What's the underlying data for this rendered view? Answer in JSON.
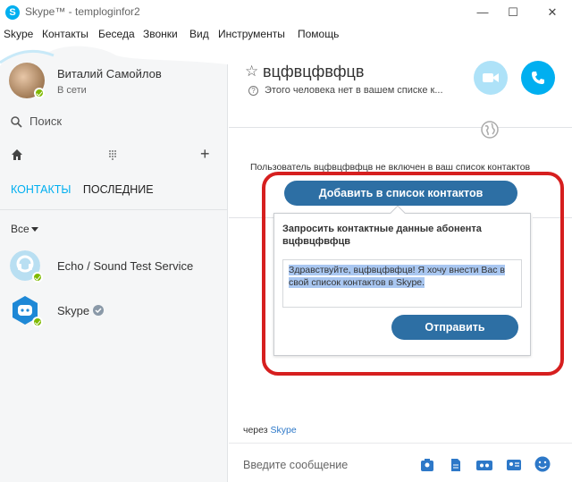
{
  "window": {
    "app_icon": "S",
    "title": "Skype™ - temploginfor2",
    "minimize": "—",
    "maximize": "☐",
    "close": "✕"
  },
  "menu": [
    "Skype",
    "Контакты",
    "Беседа",
    "Звонки",
    "Вид",
    "Инструменты",
    "Помощь"
  ],
  "profile": {
    "name": "Виталий Самойлов",
    "status": "В сети",
    "status_color": "#7fba00"
  },
  "search": {
    "label": "Поиск"
  },
  "sidebar_icons": {
    "home": "home-icon",
    "dialpad": "dialpad-icon",
    "add": "+"
  },
  "tabs": {
    "contacts": "КОНТАКТЫ",
    "recent": "ПОСЛЕДНИЕ"
  },
  "filter": {
    "label": "Все"
  },
  "contacts": [
    {
      "name": "Echo / Sound Test Service",
      "icon": "echo-avatar-icon"
    },
    {
      "name": "Skype",
      "icon": "skype-bot-avatar-icon",
      "verified": true
    }
  ],
  "chat": {
    "title": "вцфвцфвфцв",
    "subtitle": "Этого человека нет в вашем списке к...",
    "notice": "Пользователь вцфвцфвфцв не включен в ваш список контактов",
    "add_button": "Добавить в список контактов",
    "request_title": "Запросить контактные данные абонента вцфвцфвфцв",
    "request_message": "Здравствуйте, вцфвцфвфцв! Я хочу внести Вас в свой список контактов в Skype.",
    "send_button": "Отправить",
    "via_prefix": "через",
    "via_link": "Skype",
    "input_placeholder": "Введите сообщение"
  },
  "colors": {
    "accent": "#00aff0",
    "button": "#2d6fa4",
    "highlight_border": "#d61f1f",
    "selection": "#a9c7f1"
  }
}
